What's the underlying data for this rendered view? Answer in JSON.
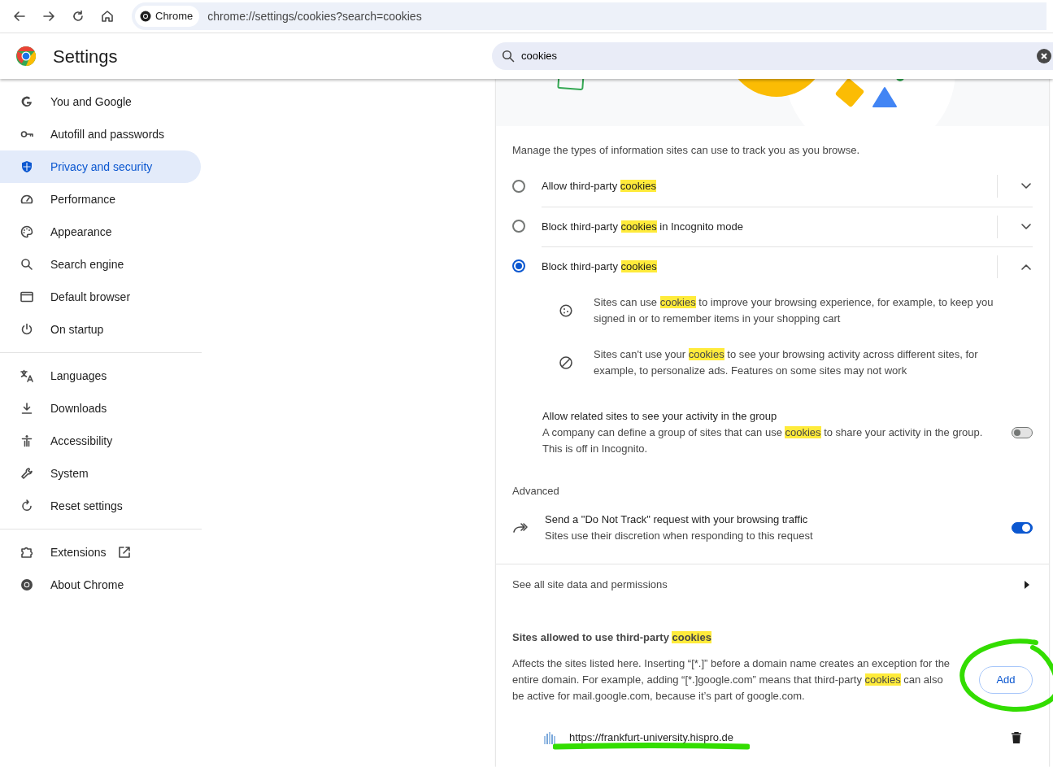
{
  "toolbar": {
    "site_chip": "Chrome",
    "url": "chrome://settings/cookies?search=cookies"
  },
  "header": {
    "title": "Settings",
    "search": {
      "value": "cookies"
    }
  },
  "sidebar": {
    "groups": [
      [
        {
          "label": "You and Google",
          "selected": false
        },
        {
          "label": "Autofill and passwords",
          "selected": false
        },
        {
          "label": "Privacy and security",
          "selected": true
        },
        {
          "label": "Performance",
          "selected": false
        },
        {
          "label": "Appearance",
          "selected": false
        },
        {
          "label": "Search engine",
          "selected": false
        },
        {
          "label": "Default browser",
          "selected": false
        },
        {
          "label": "On startup",
          "selected": false
        }
      ],
      [
        {
          "label": "Languages",
          "selected": false
        },
        {
          "label": "Downloads",
          "selected": false
        },
        {
          "label": "Accessibility",
          "selected": false
        },
        {
          "label": "System",
          "selected": false
        },
        {
          "label": "Reset settings",
          "selected": false
        }
      ],
      [
        {
          "label": "Extensions",
          "selected": false
        },
        {
          "label": "About Chrome",
          "selected": false
        }
      ]
    ]
  },
  "content": {
    "intro": "Manage the types of information sites can use to track you as you browse.",
    "options": [
      {
        "label": [
          {
            "text": "Allow third-party ",
            "highlight": false
          },
          {
            "text": "cookies",
            "highlight": true
          }
        ],
        "selected": false,
        "expanded": false
      },
      {
        "label": [
          {
            "text": "Block third-party ",
            "highlight": false
          },
          {
            "text": "cookies",
            "highlight": true
          },
          {
            "text": " in Incognito mode",
            "highlight": false
          }
        ],
        "selected": false,
        "expanded": false
      },
      {
        "label": [
          {
            "text": "Block third-party ",
            "highlight": false
          },
          {
            "text": "cookies",
            "highlight": true
          }
        ],
        "selected": true,
        "expanded": true
      }
    ],
    "details": [
      [
        {
          "text": "Sites can use ",
          "highlight": false
        },
        {
          "text": "cookies",
          "highlight": true
        },
        {
          "text": " to improve your browsing experience, for example, to keep you signed in or to remember items in your shopping cart",
          "highlight": false
        }
      ],
      [
        {
          "text": "Sites can't use your ",
          "highlight": false
        },
        {
          "text": "cookies",
          "highlight": true
        },
        {
          "text": " to see your browsing activity across different sites, for example, to personalize ads. Features on some sites may not work",
          "highlight": false
        }
      ]
    ],
    "related_sites": {
      "title": "Allow related sites to see your activity in the group",
      "description": [
        {
          "text": "A company can define a group of sites that can use ",
          "highlight": false
        },
        {
          "text": "cookies",
          "highlight": true
        },
        {
          "text": " to share your activity in the group.",
          "highlight": false
        }
      ],
      "note": "This is off in Incognito.",
      "on": false
    },
    "advanced_heading": "Advanced",
    "do_not_track": {
      "title": "Send a \"Do Not Track\" request with your browsing traffic",
      "subtitle": "Sites use their discretion when responding to this request",
      "on": true
    },
    "site_data_link": "See all site data and permissions",
    "allowed": {
      "heading": [
        {
          "text": "Sites allowed to use third-party ",
          "highlight": false
        },
        {
          "text": "cookies",
          "highlight": true
        }
      ],
      "description": [
        {
          "text": "Affects the sites listed here. Inserting “[*.]” before a domain name creates an exception for the entire domain. For example, adding “[*.]google.com” means that third-party ",
          "highlight": false
        },
        {
          "text": "cookies",
          "highlight": true
        },
        {
          "text": " can also be active for mail.google.com, because it’s part of google.com.",
          "highlight": false
        }
      ],
      "add_button": "Add",
      "sites": [
        "https://frankfurt-university.hispro.de"
      ]
    }
  }
}
